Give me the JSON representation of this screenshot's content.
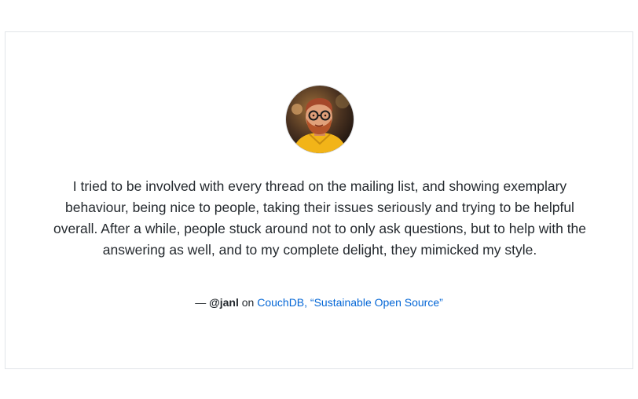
{
  "testimonial": {
    "avatar_icon": "person-photo",
    "quote": "I tried to be involved with every thread on the mailing list, and showing exemplary behaviour, being nice to people, taking their issues seriously and trying to be helpful overall. After a while, people stuck around not to only ask questions, but to help with the answering as well, and to my complete delight, they mimicked my style.",
    "dash": "—",
    "handle": "@janl",
    "on_text": "on",
    "source_link": "CouchDB, “Sustainable Open Source”"
  },
  "colors": {
    "text": "#24292e",
    "link": "#0366d6",
    "border": "#e1e4e8"
  }
}
